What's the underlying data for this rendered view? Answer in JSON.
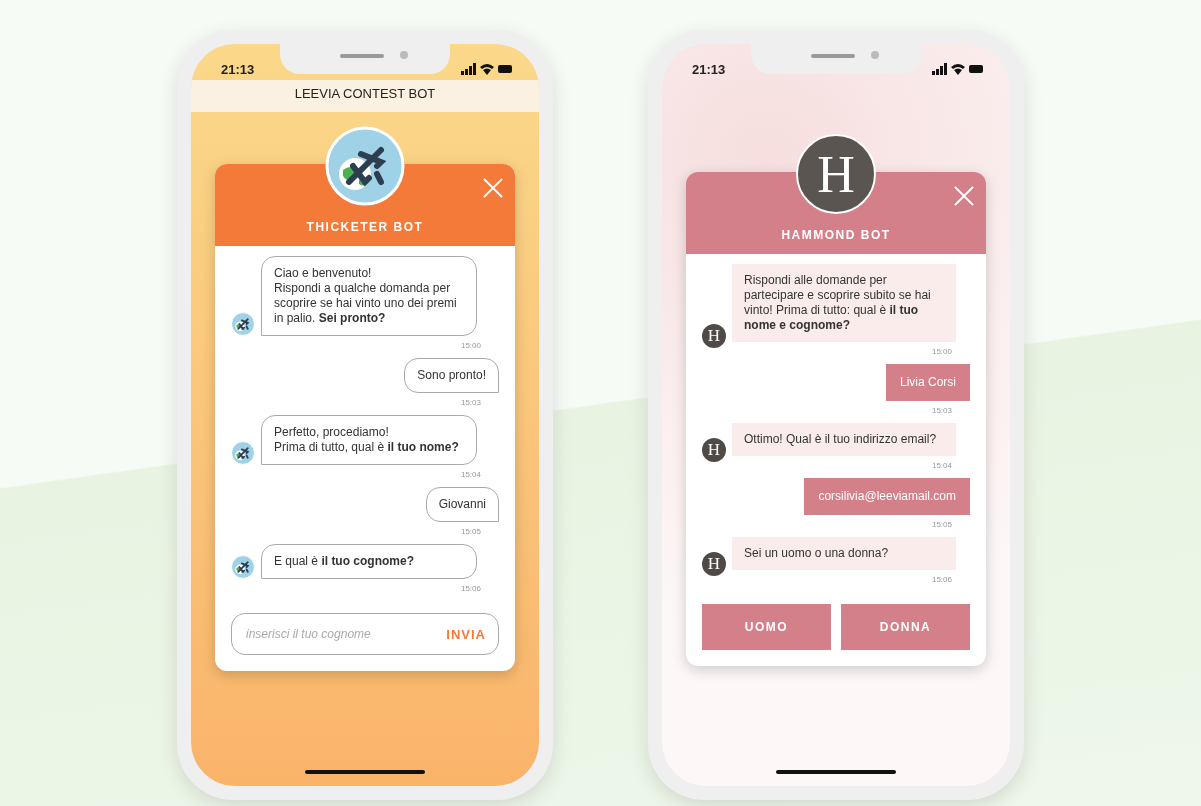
{
  "phones": [
    {
      "kind": "orange",
      "status_bar": {
        "time": "21:13"
      },
      "app_title": "LEEVIA CONTEST BOT",
      "chat": {
        "bot_name": "THICKETER BOT",
        "messages": [
          {
            "kind": "bot",
            "text": "Ciao e benvenuto!\nRispondi a qualche domanda per scoprire se hai vinto uno dei premi in palio. **Sei pronto?**",
            "time": "15:00"
          },
          {
            "kind": "user",
            "text": "Sono pronto!",
            "time": "15:03"
          },
          {
            "kind": "bot",
            "text": "Perfetto, procediamo!\nPrima di tutto, qual è **il tuo nome?**",
            "time": "15:04"
          },
          {
            "kind": "user",
            "text": "Giovanni",
            "time": "15:05"
          },
          {
            "kind": "bot",
            "text": "E qual è **il tuo cognome?**",
            "time": "15:06"
          }
        ],
        "footer": {
          "kind": "input",
          "placeholder": "inserisci il tuo cognome",
          "send": "INVIA"
        }
      }
    },
    {
      "kind": "pink",
      "status_bar": {
        "time": "21:13"
      },
      "chat": {
        "bot_name": "HAMMOND BOT",
        "logo_letter": "H",
        "messages": [
          {
            "kind": "bot",
            "avatar_letter": "H",
            "text": "Rispondi alle domande per partecipare  e scoprire subito se hai vinto! Prima di tutto: qual è **il tuo nome e cognome?**",
            "time": "15:00"
          },
          {
            "kind": "user",
            "text": "Livia Corsi",
            "time": "15:03"
          },
          {
            "kind": "bot",
            "avatar_letter": "H",
            "text": "Ottimo! Qual è il tuo indirizzo email?",
            "time": "15:04"
          },
          {
            "kind": "user",
            "text": "corsilivia@leeviamail.com",
            "time": "15:05"
          },
          {
            "kind": "bot",
            "avatar_letter": "H",
            "text": "Sei un uomo o una donna?",
            "time": "15:06"
          }
        ],
        "footer": {
          "kind": "choices",
          "options": [
            "UOMO",
            "DONNA"
          ]
        }
      }
    }
  ]
}
